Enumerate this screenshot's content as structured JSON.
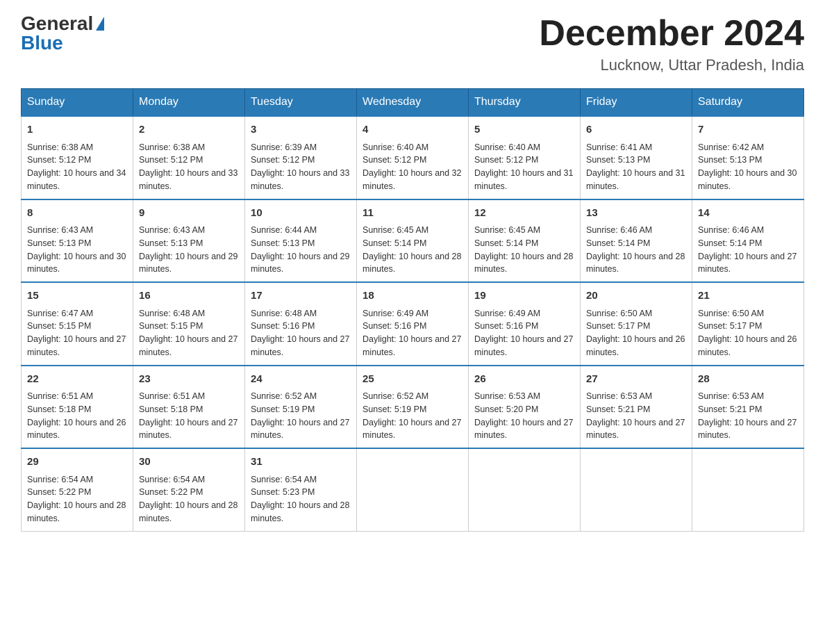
{
  "header": {
    "logo_text1": "General",
    "logo_text2": "Blue",
    "month_title": "December 2024",
    "location": "Lucknow, Uttar Pradesh, India"
  },
  "days_of_week": [
    "Sunday",
    "Monday",
    "Tuesday",
    "Wednesday",
    "Thursday",
    "Friday",
    "Saturday"
  ],
  "weeks": [
    [
      {
        "day": "1",
        "sunrise": "6:38 AM",
        "sunset": "5:12 PM",
        "daylight": "10 hours and 34 minutes."
      },
      {
        "day": "2",
        "sunrise": "6:38 AM",
        "sunset": "5:12 PM",
        "daylight": "10 hours and 33 minutes."
      },
      {
        "day": "3",
        "sunrise": "6:39 AM",
        "sunset": "5:12 PM",
        "daylight": "10 hours and 33 minutes."
      },
      {
        "day": "4",
        "sunrise": "6:40 AM",
        "sunset": "5:12 PM",
        "daylight": "10 hours and 32 minutes."
      },
      {
        "day": "5",
        "sunrise": "6:40 AM",
        "sunset": "5:12 PM",
        "daylight": "10 hours and 31 minutes."
      },
      {
        "day": "6",
        "sunrise": "6:41 AM",
        "sunset": "5:13 PM",
        "daylight": "10 hours and 31 minutes."
      },
      {
        "day": "7",
        "sunrise": "6:42 AM",
        "sunset": "5:13 PM",
        "daylight": "10 hours and 30 minutes."
      }
    ],
    [
      {
        "day": "8",
        "sunrise": "6:43 AM",
        "sunset": "5:13 PM",
        "daylight": "10 hours and 30 minutes."
      },
      {
        "day": "9",
        "sunrise": "6:43 AM",
        "sunset": "5:13 PM",
        "daylight": "10 hours and 29 minutes."
      },
      {
        "day": "10",
        "sunrise": "6:44 AM",
        "sunset": "5:13 PM",
        "daylight": "10 hours and 29 minutes."
      },
      {
        "day": "11",
        "sunrise": "6:45 AM",
        "sunset": "5:14 PM",
        "daylight": "10 hours and 28 minutes."
      },
      {
        "day": "12",
        "sunrise": "6:45 AM",
        "sunset": "5:14 PM",
        "daylight": "10 hours and 28 minutes."
      },
      {
        "day": "13",
        "sunrise": "6:46 AM",
        "sunset": "5:14 PM",
        "daylight": "10 hours and 28 minutes."
      },
      {
        "day": "14",
        "sunrise": "6:46 AM",
        "sunset": "5:14 PM",
        "daylight": "10 hours and 27 minutes."
      }
    ],
    [
      {
        "day": "15",
        "sunrise": "6:47 AM",
        "sunset": "5:15 PM",
        "daylight": "10 hours and 27 minutes."
      },
      {
        "day": "16",
        "sunrise": "6:48 AM",
        "sunset": "5:15 PM",
        "daylight": "10 hours and 27 minutes."
      },
      {
        "day": "17",
        "sunrise": "6:48 AM",
        "sunset": "5:16 PM",
        "daylight": "10 hours and 27 minutes."
      },
      {
        "day": "18",
        "sunrise": "6:49 AM",
        "sunset": "5:16 PM",
        "daylight": "10 hours and 27 minutes."
      },
      {
        "day": "19",
        "sunrise": "6:49 AM",
        "sunset": "5:16 PM",
        "daylight": "10 hours and 27 minutes."
      },
      {
        "day": "20",
        "sunrise": "6:50 AM",
        "sunset": "5:17 PM",
        "daylight": "10 hours and 26 minutes."
      },
      {
        "day": "21",
        "sunrise": "6:50 AM",
        "sunset": "5:17 PM",
        "daylight": "10 hours and 26 minutes."
      }
    ],
    [
      {
        "day": "22",
        "sunrise": "6:51 AM",
        "sunset": "5:18 PM",
        "daylight": "10 hours and 26 minutes."
      },
      {
        "day": "23",
        "sunrise": "6:51 AM",
        "sunset": "5:18 PM",
        "daylight": "10 hours and 27 minutes."
      },
      {
        "day": "24",
        "sunrise": "6:52 AM",
        "sunset": "5:19 PM",
        "daylight": "10 hours and 27 minutes."
      },
      {
        "day": "25",
        "sunrise": "6:52 AM",
        "sunset": "5:19 PM",
        "daylight": "10 hours and 27 minutes."
      },
      {
        "day": "26",
        "sunrise": "6:53 AM",
        "sunset": "5:20 PM",
        "daylight": "10 hours and 27 minutes."
      },
      {
        "day": "27",
        "sunrise": "6:53 AM",
        "sunset": "5:21 PM",
        "daylight": "10 hours and 27 minutes."
      },
      {
        "day": "28",
        "sunrise": "6:53 AM",
        "sunset": "5:21 PM",
        "daylight": "10 hours and 27 minutes."
      }
    ],
    [
      {
        "day": "29",
        "sunrise": "6:54 AM",
        "sunset": "5:22 PM",
        "daylight": "10 hours and 28 minutes."
      },
      {
        "day": "30",
        "sunrise": "6:54 AM",
        "sunset": "5:22 PM",
        "daylight": "10 hours and 28 minutes."
      },
      {
        "day": "31",
        "sunrise": "6:54 AM",
        "sunset": "5:23 PM",
        "daylight": "10 hours and 28 minutes."
      },
      null,
      null,
      null,
      null
    ]
  ],
  "labels": {
    "sunrise": "Sunrise:",
    "sunset": "Sunset:",
    "daylight": "Daylight:"
  }
}
